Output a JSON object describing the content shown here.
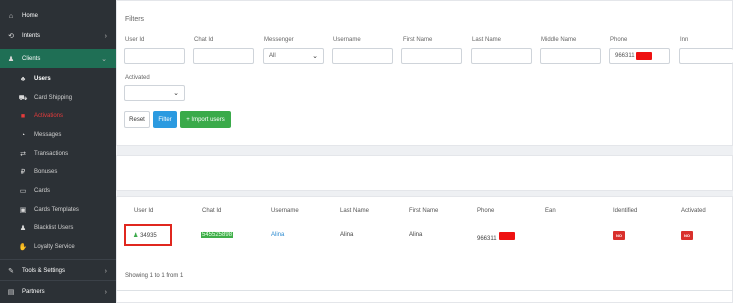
{
  "sidebar": {
    "items": [
      {
        "label": "Home",
        "icon": "home-icon",
        "glyph": "⌂"
      },
      {
        "label": "Intents",
        "icon": "intents-icon",
        "glyph": "⟲"
      },
      {
        "label": "Clients",
        "icon": "clients-icon",
        "glyph": "♟"
      },
      {
        "label": "Users",
        "icon": "users-icon",
        "glyph": "👥"
      },
      {
        "label": "Card Shipping",
        "icon": "truck-icon",
        "glyph": "⛟"
      },
      {
        "label": "Activations",
        "icon": "activation-icon",
        "glyph": "■"
      },
      {
        "label": "Messages",
        "icon": "message-icon",
        "glyph": "💬"
      },
      {
        "label": "Transactions",
        "icon": "transactions-icon",
        "glyph": "⇄"
      },
      {
        "label": "Bonuses",
        "icon": "bonus-icon",
        "glyph": "₽"
      },
      {
        "label": "Cards",
        "icon": "card-icon",
        "glyph": "▭"
      },
      {
        "label": "Cards Templates",
        "icon": "template-icon",
        "glyph": "▣"
      },
      {
        "label": "Blacklist Users",
        "icon": "blacklist-icon",
        "glyph": "👤"
      },
      {
        "label": "Loyalty Service",
        "icon": "loyalty-icon",
        "glyph": "👍"
      },
      {
        "label": "Tools & Settings",
        "icon": "wrench-icon",
        "glyph": "🔧"
      },
      {
        "label": "Partners",
        "icon": "partners-icon",
        "glyph": "▤"
      }
    ]
  },
  "filters": {
    "title": "Filters",
    "labels": {
      "user_id": "User Id",
      "chat_id": "Chat Id",
      "messenger": "Messenger",
      "username": "Username",
      "first_name": "First Name",
      "last_name": "Last Name",
      "middle_name": "Middle Name",
      "phone": "Phone",
      "inn": "Inn",
      "activated": "Activated"
    },
    "messenger_value": "All",
    "phone_value": "966311",
    "activated_value": ""
  },
  "buttons": {
    "reset": "Reset",
    "filter": "Filter",
    "import": "+ Import users"
  },
  "table": {
    "headers": [
      "User Id",
      "Chat Id",
      "Username",
      "Last Name",
      "First Name",
      "Phone",
      "Ean",
      "Identified",
      "Activated"
    ],
    "row": {
      "user_id": "34935",
      "chat_id": "545525898",
      "username": "Alina",
      "last_name": "Alina",
      "first_name": "Alina",
      "phone": "966311",
      "ean": "",
      "identified": "NO",
      "activated": "NO"
    },
    "footer": "Showing 1 to 1 from 1"
  }
}
